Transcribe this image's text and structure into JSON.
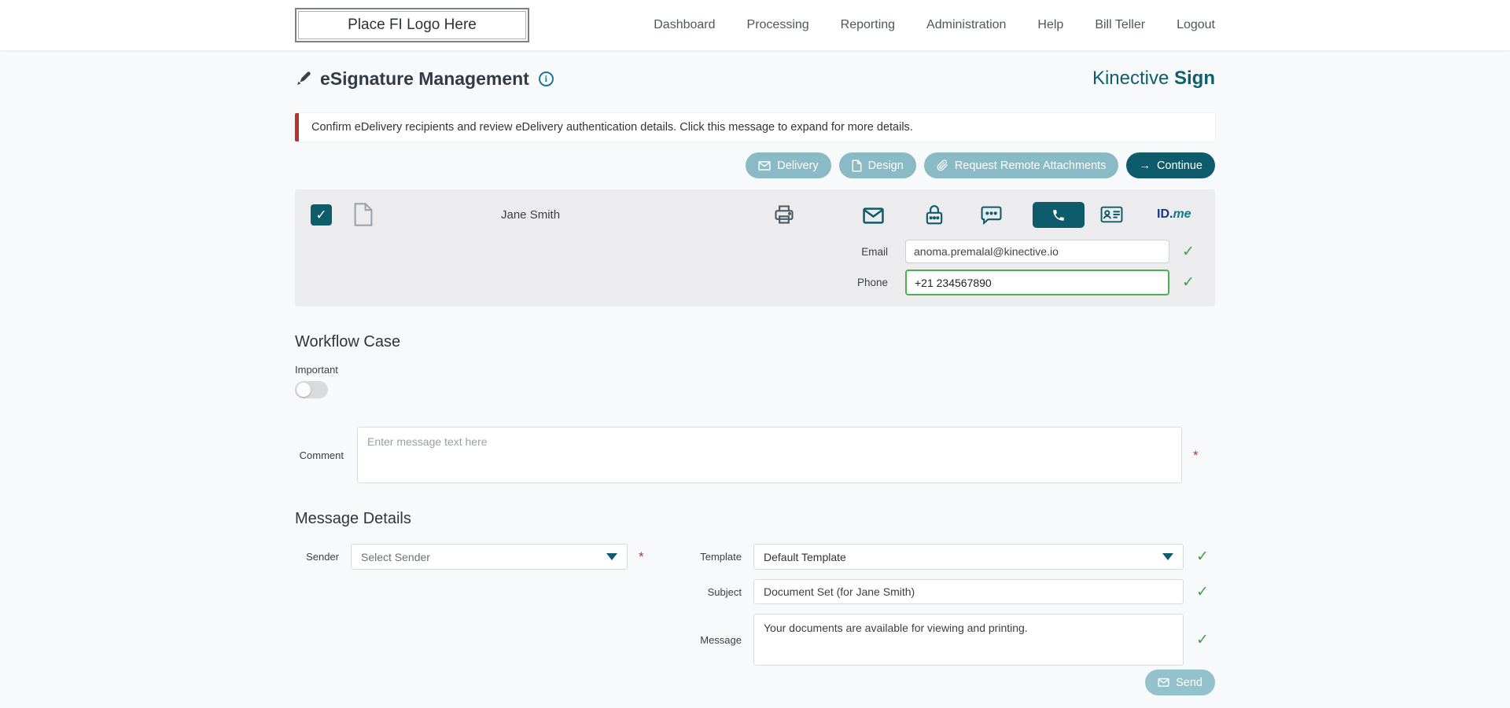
{
  "header": {
    "logo_text": "Place FI Logo Here",
    "nav": [
      "Dashboard",
      "Processing",
      "Reporting",
      "Administration",
      "Help",
      "Bill Teller",
      "Logout"
    ]
  },
  "page": {
    "title": "eSignature Management",
    "brand_name": "Kinective",
    "brand_suffix": "Sign",
    "alert": "Confirm eDelivery recipients and review eDelivery authentication details. Click this message to expand for more details."
  },
  "actions": {
    "delivery": "Delivery",
    "design": "Design",
    "attachments": "Request Remote Attachments",
    "continue": "Continue"
  },
  "recipient": {
    "name": "Jane Smith",
    "email_label": "Email",
    "email_value": "anoma.premalal@kinective.io",
    "phone_label": "Phone",
    "phone_value": "+21 234567890",
    "idme_id": "ID.",
    "idme_me": "me"
  },
  "workflow": {
    "title": "Workflow Case",
    "important_label": "Important",
    "comment_label": "Comment",
    "comment_placeholder": "Enter message text here"
  },
  "md": {
    "title": "Message Details",
    "sender_label": "Sender",
    "sender_value": "Select Sender",
    "template_label": "Template",
    "template_value": "Default Template",
    "subject_label": "Subject",
    "subject_value": "Document Set (for Jane Smith)",
    "message_label": "Message",
    "message_value": "Your documents are available for viewing and printing.",
    "send_label": "Send"
  },
  "icons": {
    "check": "✓",
    "arrow_right": "→",
    "required": "*"
  },
  "colors": {
    "dark_teal": "#0e5c6b",
    "light_teal": "#89bac5",
    "green": "#43a047",
    "alert_red": "#b5342c"
  }
}
